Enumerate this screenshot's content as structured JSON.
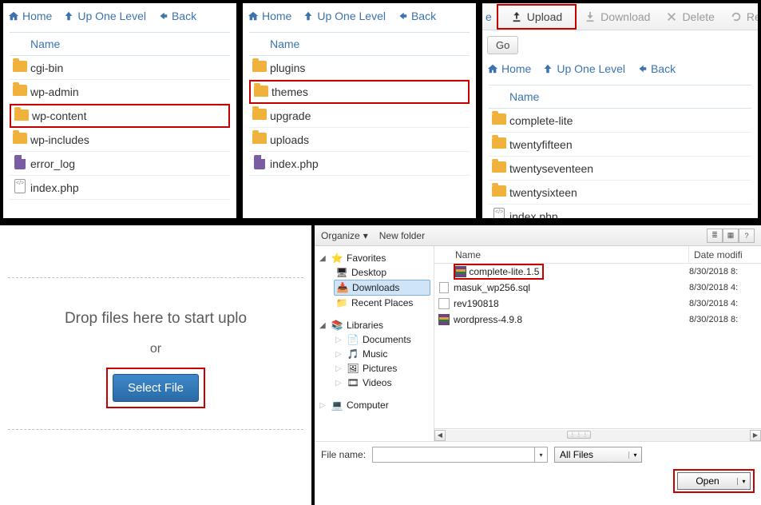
{
  "nav": {
    "home": "Home",
    "up": "Up One Level",
    "back": "Back",
    "upload": "Upload",
    "download": "Download",
    "delete": "Delete",
    "re": "Re",
    "go": "Go"
  },
  "col": {
    "name": "Name"
  },
  "panel1": {
    "items": [
      {
        "type": "folder",
        "label": "cgi-bin"
      },
      {
        "type": "folder",
        "label": "wp-admin"
      },
      {
        "type": "folder",
        "label": "wp-content",
        "highlight": true
      },
      {
        "type": "folder",
        "label": "wp-includes"
      },
      {
        "type": "file",
        "label": "error_log"
      },
      {
        "type": "code",
        "label": "index.php"
      }
    ]
  },
  "panel2": {
    "items": [
      {
        "type": "folder",
        "label": "plugins"
      },
      {
        "type": "folder",
        "label": "themes",
        "highlight": true
      },
      {
        "type": "folder",
        "label": "upgrade"
      },
      {
        "type": "folder",
        "label": "uploads"
      },
      {
        "type": "file",
        "label": "index.php"
      }
    ]
  },
  "panel3": {
    "items": [
      {
        "type": "folder",
        "label": "complete-lite"
      },
      {
        "type": "folder",
        "label": "twentyfifteen"
      },
      {
        "type": "folder",
        "label": "twentyseventeen"
      },
      {
        "type": "folder",
        "label": "twentysixteen"
      },
      {
        "type": "code",
        "label": "index.php"
      }
    ]
  },
  "drop": {
    "text": "Drop files here to start uplo",
    "or": "or",
    "select": "Select File"
  },
  "win": {
    "organize": "Organize",
    "newfolder": "New folder",
    "tree": {
      "favorites": "Favorites",
      "desktop": "Desktop",
      "downloads": "Downloads",
      "recent": "Recent Places",
      "libraries": "Libraries",
      "documents": "Documents",
      "music": "Music",
      "pictures": "Pictures",
      "videos": "Videos",
      "computer": "Computer"
    },
    "hdr": {
      "name": "Name",
      "date": "Date modifi"
    },
    "files": [
      {
        "icon": "rar",
        "name": "complete-lite.1.5",
        "date": "8/30/2018 8:",
        "highlight": true
      },
      {
        "icon": "txt",
        "name": "masuk_wp256.sql",
        "date": "8/30/2018 4:"
      },
      {
        "icon": "sql",
        "name": "rev190818",
        "date": "8/30/2018 4:"
      },
      {
        "icon": "rar",
        "name": "wordpress-4.9.8",
        "date": "8/30/2018 8:"
      }
    ],
    "filename_label": "File name:",
    "filter": "All Files",
    "open": "Open"
  }
}
